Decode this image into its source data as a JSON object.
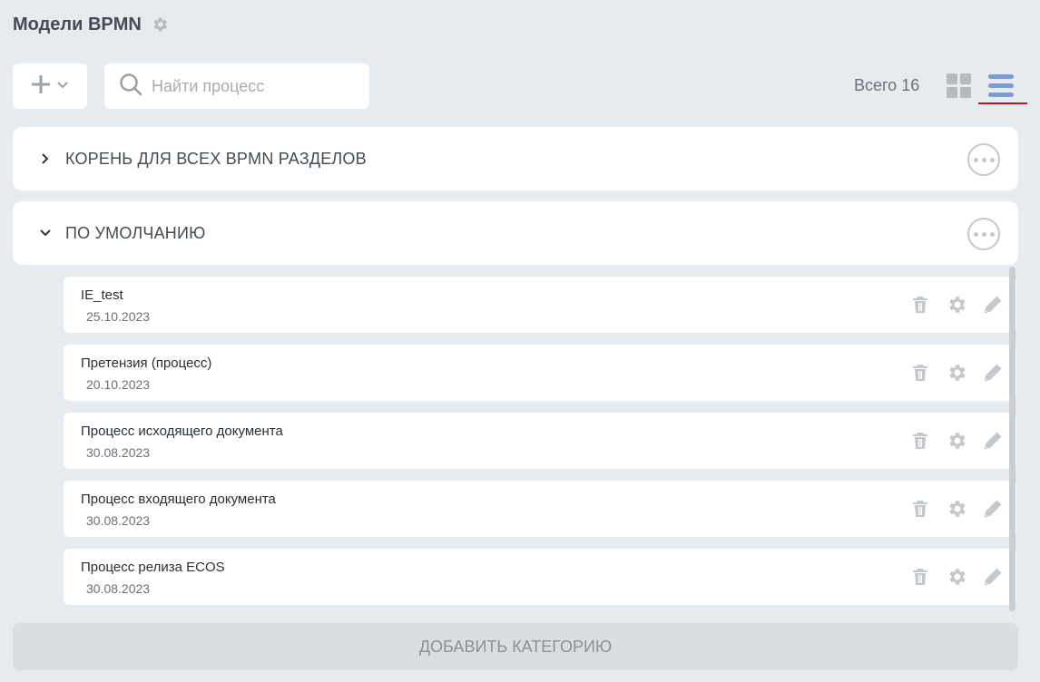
{
  "header": {
    "title": "Модели BPMN"
  },
  "toolbar": {
    "search_placeholder": "Найти процесс",
    "total_label": "Всего 16"
  },
  "categories": [
    {
      "label": "КОРЕНЬ ДЛЯ ВСЕХ BPMN РАЗДЕЛОВ",
      "expanded": false
    },
    {
      "label": "ПО УМОЛЧАНИЮ",
      "expanded": true
    }
  ],
  "processes": [
    {
      "name": "IE_test",
      "date": "25.10.2023"
    },
    {
      "name": "Претензия (процесс)",
      "date": "20.10.2023"
    },
    {
      "name": "Процесс исходящего документа",
      "date": "30.08.2023"
    },
    {
      "name": "Процесс входящего документа",
      "date": "30.08.2023"
    },
    {
      "name": "Процесс релиза ECOS",
      "date": "30.08.2023"
    }
  ],
  "footer": {
    "add_category_label": "ДОБАВИТЬ КАТЕГОРИЮ"
  },
  "colors": {
    "accent": "#7c9bd1",
    "active_underline": "#e3001b",
    "icon_gray": "#c4c8cc"
  }
}
